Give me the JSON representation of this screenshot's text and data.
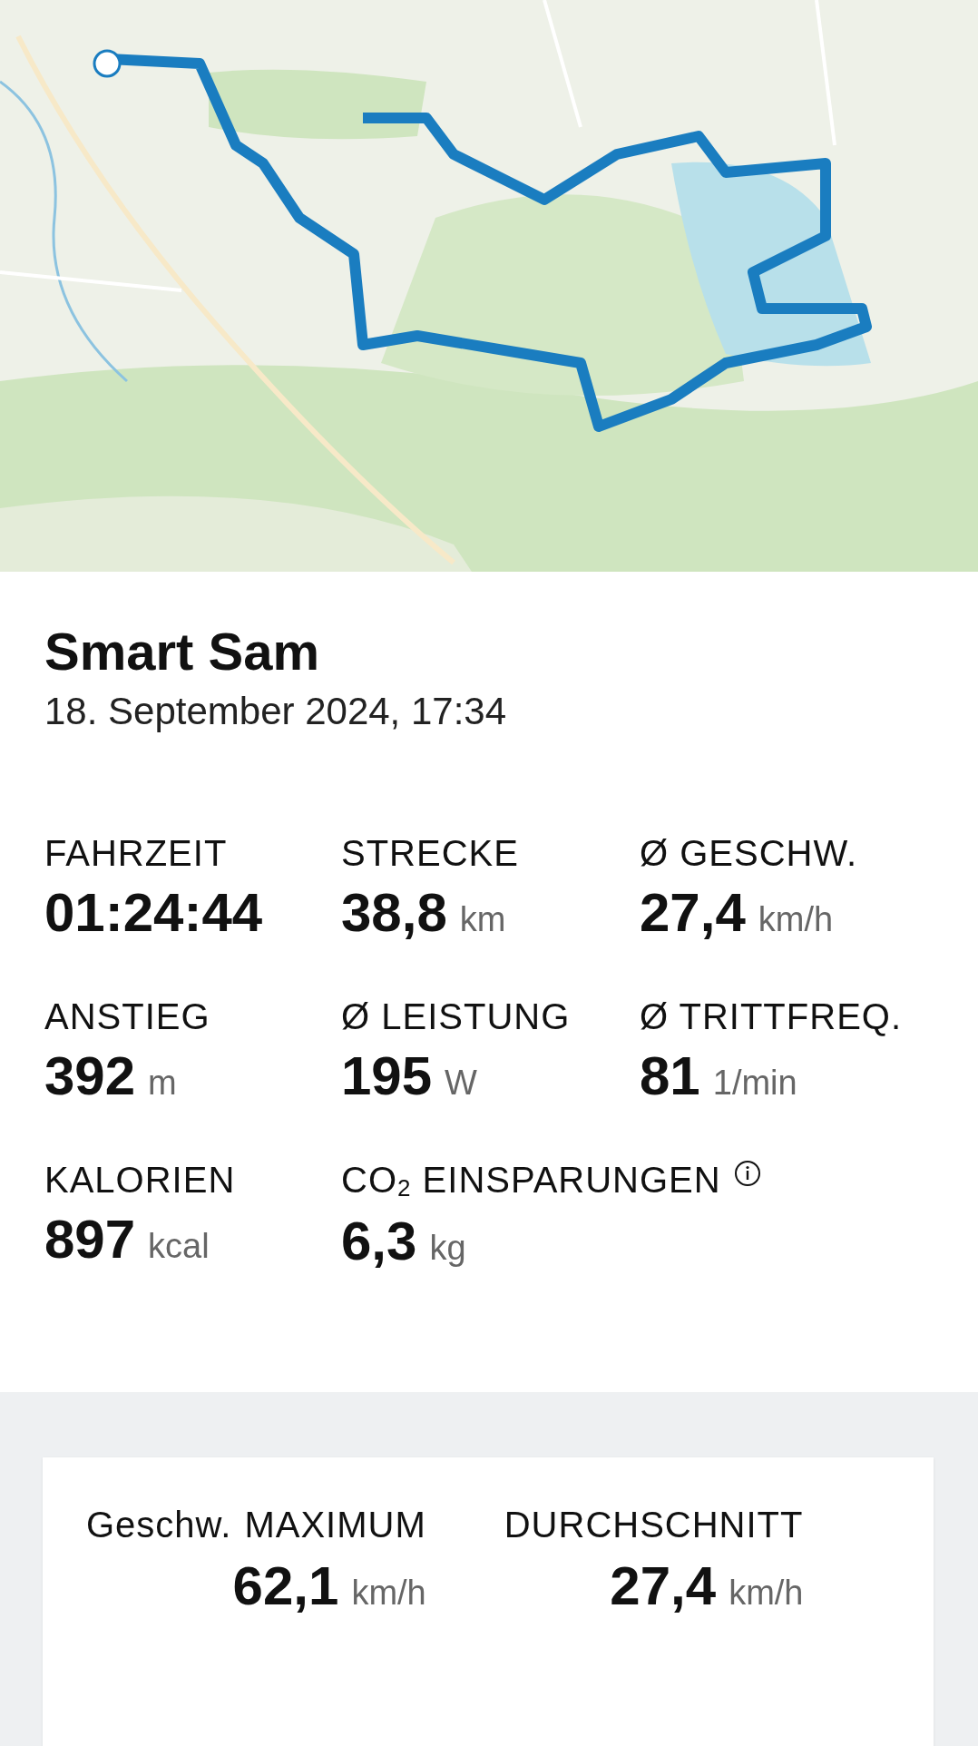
{
  "ride": {
    "title": "Smart Sam",
    "date": "18. September 2024, 17:34"
  },
  "stats": [
    {
      "label": "FAHRZEIT",
      "value": "01:24:44"
    },
    {
      "label": "STRECKE",
      "value": "38,8",
      "unit": "km"
    },
    {
      "label": "Ø GESCHW.",
      "value": "27,4",
      "unit": "km/h"
    },
    {
      "label": "ANSTIEG",
      "value": "392",
      "unit": "m"
    },
    {
      "label": "Ø LEISTUNG",
      "value": "195",
      "unit": "W"
    },
    {
      "label": "Ø TRITTFREQ.",
      "value": "81",
      "unit": "1/min"
    },
    {
      "label": "KALORIEN",
      "value": "897",
      "unit": "kcal"
    },
    {
      "label": "CO$_{2}$ EINSPARUNGEN",
      "value": "6,3",
      "unit": "kg",
      "info": true
    }
  ],
  "speed_card": {
    "title": "Geschw.",
    "columns": [
      {
        "label": "MAXIMUM",
        "value": "62,1",
        "unit": "km/h"
      },
      {
        "label": "DURCHSCHNITT",
        "value": "27,4",
        "unit": "km/h"
      }
    ]
  }
}
